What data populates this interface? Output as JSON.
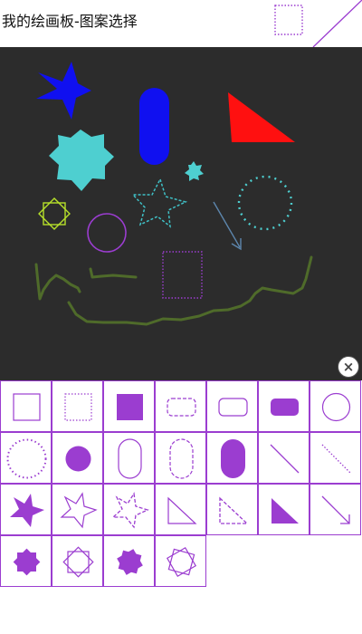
{
  "app": {
    "title": "我的绘画板-图案选择"
  },
  "toolbar": {
    "close_label": "×"
  },
  "colors": {
    "accent": "#9b3dd0",
    "canvas_bg": "#2c2c2c"
  },
  "palette": {
    "items": [
      "square-outline",
      "square-dotted",
      "square-filled",
      "rounded-rect-dashed",
      "rounded-rect-outline",
      "rounded-rect-filled",
      "circle-outline",
      "circle-dotted",
      "circle-filled",
      "capsule-outline",
      "capsule-dashed",
      "capsule-filled",
      "line",
      "line-dotted",
      "star-filled",
      "star-outline",
      "star-dashed",
      "triangle-outline",
      "triangle-dashed",
      "triangle-filled",
      "arrow",
      "burst-filled",
      "octagram-outline",
      "burst-filled-alt",
      "octagram-outline-alt"
    ]
  }
}
